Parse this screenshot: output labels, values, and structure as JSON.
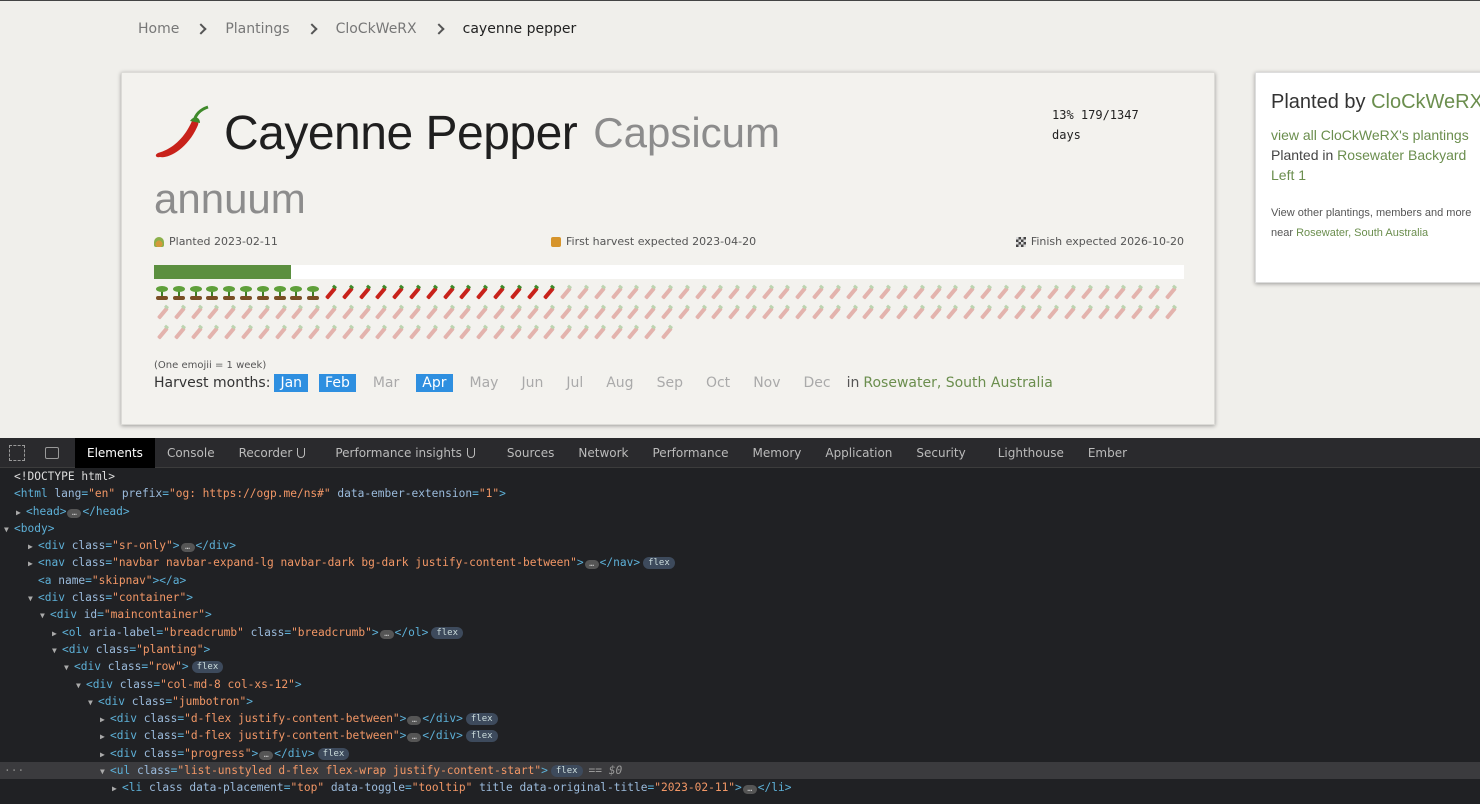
{
  "breadcrumb": [
    "Home",
    "Plantings",
    "CloCkWeRX",
    "cayenne pepper"
  ],
  "planting": {
    "crop_name": "Cayenne Pepper",
    "scientific_name_1": "Capsicum",
    "scientific_name_2": "annuum",
    "progress_text": "13% 179/1347",
    "progress_unit": "days",
    "progress_fraction": 0.133,
    "planted": "Planted 2023-02-11",
    "first_harvest": "First harvest expected 2023-04-20",
    "finish": "Finish expected 2026-10-20",
    "emoji_note": "(One emojii = 1 week)",
    "weeks": {
      "sprout": 10,
      "pepper": 14,
      "faded": 129
    },
    "harvest_label": "Harvest months:",
    "months": [
      {
        "m": "Jan",
        "on": true
      },
      {
        "m": "Feb",
        "on": true
      },
      {
        "m": "Mar",
        "on": false
      },
      {
        "m": "Apr",
        "on": true
      },
      {
        "m": "May",
        "on": false
      },
      {
        "m": "Jun",
        "on": false
      },
      {
        "m": "Jul",
        "on": false
      },
      {
        "m": "Aug",
        "on": false
      },
      {
        "m": "Sep",
        "on": false
      },
      {
        "m": "Oct",
        "on": false
      },
      {
        "m": "Nov",
        "on": false
      },
      {
        "m": "Dec",
        "on": false
      }
    ],
    "in_text": "in",
    "location": "Rosewater, South Australia"
  },
  "sidebar": {
    "planted_by": "Planted by",
    "owner": "CloCkWeRX",
    "view_all": "view all CloCkWeRX's plantings",
    "planted_in": "Planted in",
    "garden": "Rosewater Backyard Left 1",
    "view_other": "View other plantings, members and more",
    "near": "near",
    "near_location": "Rosewater, South Australia"
  },
  "devtools": {
    "tabs": [
      "Elements",
      "Console",
      "Recorder",
      "Performance insights",
      "Sources",
      "Network",
      "Performance",
      "Memory",
      "Application",
      "Security",
      "Lighthouse",
      "Ember"
    ],
    "lines": [
      {
        "t": "<!DOCTYPE html>"
      },
      {
        "t": "<html lang=\"en\" prefix=\"og: https://ogp.me/ns#\" data-ember-extension=\"1\">"
      },
      {
        "t": "<head>…</head>"
      },
      {
        "t": "<body>"
      },
      {
        "t": "<div class=\"sr-only\">…</div>"
      },
      {
        "t": "<nav class=\"navbar navbar-expand-lg navbar-dark bg-dark justify-content-between\">…</nav>",
        "badge": "flex"
      },
      {
        "t": "<a name=\"skipnav\"></a>"
      },
      {
        "t": "<div class=\"container\">"
      },
      {
        "t": "<div id=\"maincontainer\">"
      },
      {
        "t": "<ol aria-label=\"breadcrumb\" class=\"breadcrumb\">…</ol>",
        "badge": "flex"
      },
      {
        "t": "<div class=\"planting\">"
      },
      {
        "t": "<div class=\"row\">",
        "badge": "flex"
      },
      {
        "t": "<div class=\"col-md-8 col-xs-12\">"
      },
      {
        "t": "<div class=\"jumbotron\">"
      },
      {
        "t": "<div class=\"d-flex justify-content-between\">…</div>",
        "badge": "flex"
      },
      {
        "t": "<div class=\"d-flex justify-content-between\">…</div>",
        "badge": "flex"
      },
      {
        "t": "<div class=\"progress\">…</div>",
        "badge": "flex"
      },
      {
        "t": "<ul class=\"list-unstyled d-flex flex-wrap justify-content-start\">",
        "badge": "flex",
        "eq": "== $0"
      },
      {
        "t": "<li class data-placement=\"top\" data-toggle=\"tooltip\" title data-original-title=\"2023-02-11\">…</li>"
      }
    ]
  }
}
